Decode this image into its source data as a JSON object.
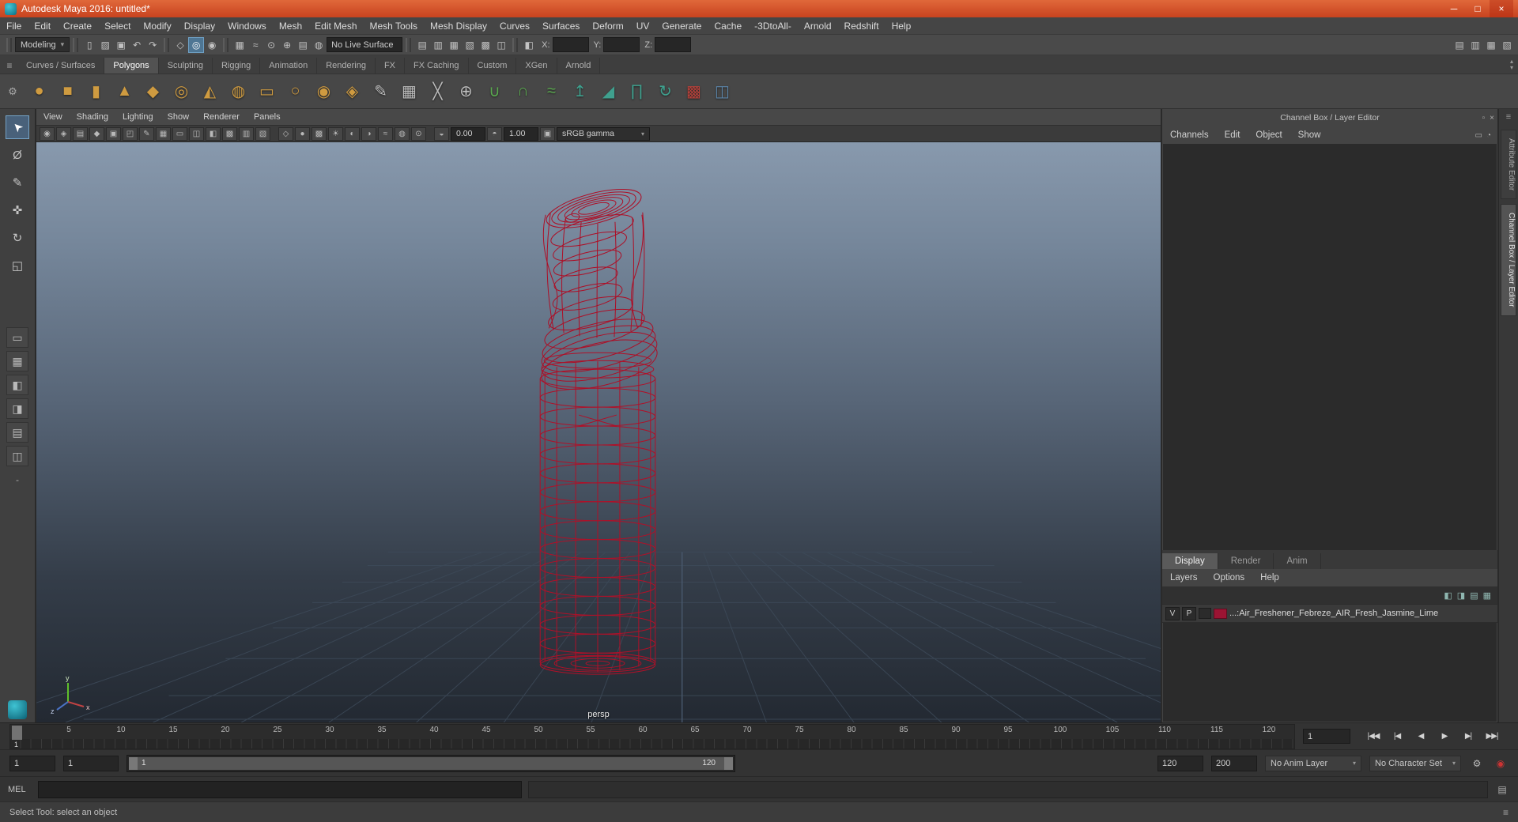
{
  "window": {
    "title": "Autodesk Maya 2016: untitled*",
    "minimize": "─",
    "maximize": "□",
    "close": "×"
  },
  "menubar": {
    "items": [
      "File",
      "Edit",
      "Create",
      "Select",
      "Modify",
      "Display",
      "Windows",
      "Mesh",
      "Edit Mesh",
      "Mesh Tools",
      "Mesh Display",
      "Curves",
      "Surfaces",
      "Deform",
      "UV",
      "Generate",
      "Cache",
      "-3DtoAll-",
      "Arnold",
      "Redshift",
      "Help"
    ]
  },
  "statusline": {
    "mode": "Modeling",
    "mode_arrow": "▾",
    "file_icons": [
      {
        "name": "new-scene-icon",
        "glyph": "▯"
      },
      {
        "name": "open-scene-icon",
        "glyph": "▨"
      },
      {
        "name": "save-scene-icon",
        "glyph": "▣"
      }
    ],
    "undo_icons": [
      {
        "name": "undo-icon",
        "glyph": "↶"
      },
      {
        "name": "redo-icon",
        "glyph": "↷"
      }
    ],
    "selection_icons": [
      {
        "name": "select-hierarchy-icon",
        "glyph": "◇"
      },
      {
        "name": "select-object-icon",
        "glyph": "◎",
        "cls": "sicon active"
      },
      {
        "name": "select-component-icon",
        "glyph": "◉"
      }
    ],
    "snap_icons": [
      {
        "name": "snap-grid-icon",
        "glyph": "▦"
      },
      {
        "name": "snap-curve-icon",
        "glyph": "≈"
      },
      {
        "name": "snap-point-icon",
        "glyph": "⊙"
      },
      {
        "name": "snap-projected-center-icon",
        "glyph": "⊕"
      },
      {
        "name": "snap-view-plane-icon",
        "glyph": "▤"
      },
      {
        "name": "make-live-icon",
        "glyph": "◍"
      }
    ],
    "live_surface": "No Live Surface",
    "history_icons": [
      {
        "name": "input-operations-icon",
        "glyph": "▤"
      },
      {
        "name": "input-connections-icon",
        "glyph": "▥"
      },
      {
        "name": "output-connections-icon",
        "glyph": "▦"
      },
      {
        "name": "construction-history-icon",
        "glyph": "▧"
      },
      {
        "name": "render-view-icon",
        "glyph": "▩"
      },
      {
        "name": "ipr-render-icon",
        "glyph": "◫"
      }
    ],
    "symmetry_icon": {
      "glyph": "◧"
    },
    "coords": {
      "x_label": "X:",
      "y_label": "Y:",
      "z_label": "Z:"
    },
    "right_icons": [
      {
        "name": "modeling-toolkit-icon",
        "glyph": "▤"
      },
      {
        "name": "attribute-editor-toggle-icon",
        "glyph": "▥"
      },
      {
        "name": "tool-settings-toggle-icon",
        "glyph": "▦"
      },
      {
        "name": "channel-box-toggle-icon",
        "glyph": "▧"
      }
    ]
  },
  "shelf": {
    "menu_icon": "≡",
    "gear_icon": "⚙",
    "scroll_up": "▴",
    "scroll_down": "▾",
    "tabs": [
      {
        "label": "Curves / Surfaces"
      },
      {
        "label": "Polygons",
        "cls": "shelf-tab active"
      },
      {
        "label": "Sculpting"
      },
      {
        "label": "Rigging"
      },
      {
        "label": "Animation"
      },
      {
        "label": "Rendering"
      },
      {
        "label": "FX"
      },
      {
        "label": "FX Caching"
      },
      {
        "label": "Custom"
      },
      {
        "label": "XGen"
      },
      {
        "label": "Arnold"
      }
    ],
    "icons": [
      {
        "name": "poly-sphere-icon",
        "glyph": "●",
        "color": "#cf9b40"
      },
      {
        "name": "poly-cube-icon",
        "glyph": "■",
        "color": "#cf9b40"
      },
      {
        "name": "poly-cylinder-icon",
        "glyph": "▮",
        "color": "#cf9b40"
      },
      {
        "name": "poly-cone-icon",
        "glyph": "▲",
        "color": "#cf9b40"
      },
      {
        "name": "poly-platonic-icon",
        "glyph": "◆",
        "color": "#cf9b40"
      },
      {
        "name": "poly-torus-icon",
        "glyph": "◎",
        "color": "#cf9b40"
      },
      {
        "name": "poly-pyramid-icon",
        "glyph": "◭",
        "color": "#cf9b40"
      },
      {
        "name": "poly-pipe-icon",
        "glyph": "◍",
        "color": "#cf9b40"
      },
      {
        "name": "poly-plane-icon",
        "glyph": "▭",
        "color": "#cf9b40"
      },
      {
        "name": "poly-disc-icon",
        "glyph": "○",
        "color": "#cf9b40"
      },
      {
        "name": "poly-super-ellipse-icon",
        "glyph": "◉",
        "color": "#cf9b40"
      },
      {
        "name": "poly-gear-icon",
        "glyph": "◈",
        "color": "#cf9b40"
      },
      {
        "name": "create-polygon-tool-icon",
        "glyph": "✎",
        "color": "#bdbdbd"
      },
      {
        "name": "quad-draw-tool-icon",
        "glyph": "▦",
        "color": "#bdbdbd"
      },
      {
        "name": "multi-cut-tool-icon",
        "glyph": "╳",
        "color": "#bdbdbd"
      },
      {
        "name": "target-weld-tool-icon",
        "glyph": "⊕",
        "color": "#bdbdbd"
      },
      {
        "name": "combine-icon",
        "glyph": "∪",
        "color": "#5aa84f"
      },
      {
        "name": "separate-icon",
        "glyph": "∩",
        "color": "#5aa84f"
      },
      {
        "name": "smooth-icon",
        "glyph": "≈",
        "color": "#5aa84f"
      },
      {
        "name": "extrude-icon",
        "glyph": "↥",
        "color": "#3fa08e"
      },
      {
        "name": "bevel-icon",
        "glyph": "◢",
        "color": "#3fa08e"
      },
      {
        "name": "bridge-icon",
        "glyph": "∏",
        "color": "#3fa08e"
      },
      {
        "name": "spin-edge-icon",
        "glyph": "↻",
        "color": "#3fa08e"
      },
      {
        "name": "boolean-icon",
        "glyph": "▩",
        "color": "#b5413a"
      },
      {
        "name": "mirror-icon",
        "glyph": "◫",
        "color": "#5b84a8"
      }
    ]
  },
  "toolbox": {
    "tools": [
      {
        "name": "select-tool",
        "glyph": "➤",
        "cls": "tool active arrow"
      },
      {
        "name": "lasso-tool",
        "glyph": "Ø"
      },
      {
        "name": "paint-select-tool",
        "glyph": "✎"
      },
      {
        "name": "move-tool",
        "glyph": "✜"
      },
      {
        "name": "rotate-tool",
        "glyph": "↻"
      },
      {
        "name": "scale-tool",
        "glyph": "◱"
      }
    ],
    "layouts": [
      {
        "name": "single-pane-layout",
        "glyph": "▭"
      },
      {
        "name": "four-pane-layout",
        "glyph": "▦"
      },
      {
        "name": "persp-outliner-layout",
        "glyph": "◧"
      },
      {
        "name": "persp-panels-layout",
        "glyph": "◨"
      },
      {
        "name": "hypershade-layout",
        "glyph": "▤"
      },
      {
        "name": "uv-editor-layout",
        "glyph": "◫"
      }
    ],
    "collapse": "-"
  },
  "panel": {
    "menus": [
      "View",
      "Shading",
      "Lighting",
      "Show",
      "Renderer",
      "Panels"
    ],
    "view_icons": [
      {
        "name": "camera-icon",
        "glyph": "◉"
      },
      {
        "name": "lock-camera-icon",
        "glyph": "◈"
      },
      {
        "name": "camera-attributes-icon",
        "glyph": "▤"
      },
      {
        "name": "bookmark-icon",
        "glyph": "◆"
      },
      {
        "name": "image-plane-icon",
        "glyph": "▣"
      },
      {
        "name": "pan-zoom-icon",
        "glyph": "◰"
      },
      {
        "name": "grease-pencil-icon",
        "glyph": "✎"
      },
      {
        "name": "grid-icon",
        "glyph": "▦"
      },
      {
        "name": "film-gate-icon",
        "glyph": "▭"
      },
      {
        "name": "resolution-gate-icon",
        "glyph": "◫"
      },
      {
        "name": "gate-mask-icon",
        "glyph": "◧"
      },
      {
        "name": "field-chart-icon",
        "glyph": "▩"
      },
      {
        "name": "safe-action-icon",
        "glyph": "▥"
      },
      {
        "name": "safe-title-icon",
        "glyph": "▧"
      }
    ],
    "shading_icons": [
      {
        "name": "wireframe-icon",
        "glyph": "◇"
      },
      {
        "name": "smooth-shade-icon",
        "glyph": "●"
      },
      {
        "name": "textured-icon",
        "glyph": "▩"
      },
      {
        "name": "lights-icon",
        "glyph": "☀"
      },
      {
        "name": "shadows-icon",
        "glyph": "◐"
      },
      {
        "name": "ambient-occlusion-icon",
        "glyph": "◑"
      },
      {
        "name": "motion-blur-icon",
        "glyph": "≈"
      },
      {
        "name": "xray-icon",
        "glyph": "◍"
      },
      {
        "name": "isolate-select-icon",
        "glyph": "⊙"
      }
    ],
    "exposure_icon": "◒",
    "exposure": "0.00",
    "contrast_icon": "◓",
    "gamma": "1.00",
    "colorspace_icon": "▣",
    "colorspace": "sRGB gamma",
    "combo_arrow": "▾",
    "camera": "persp",
    "axis": {
      "x": "x",
      "y": "y",
      "z": "z"
    }
  },
  "channelbox": {
    "title": "Channel Box / Layer Editor",
    "pin_icon": "▫",
    "close_icon": "×",
    "menus": [
      "Channels",
      "Edit",
      "Object",
      "Show"
    ],
    "mode_icons": [
      {
        "name": "slider-mode-icon",
        "glyph": "▭"
      },
      {
        "name": "speed-mode-icon",
        "glyph": "◔"
      }
    ],
    "tabs": [
      {
        "label": "Display",
        "cls": "cb-tab active"
      },
      {
        "label": "Render"
      },
      {
        "label": "Anim"
      }
    ],
    "layer_menus": [
      "Layers",
      "Options",
      "Help"
    ],
    "layer_icons": [
      {
        "name": "layer-visibility-icon",
        "glyph": "◧"
      },
      {
        "name": "layer-playback-icon",
        "glyph": "◨"
      },
      {
        "name": "new-empty-layer-icon",
        "glyph": "▤"
      },
      {
        "name": "new-layer-from-selected-icon",
        "glyph": "▦"
      }
    ],
    "layer": {
      "visible": "V",
      "playback": "P",
      "color": "#9b1433",
      "name": "...:Air_Freshener_Febreze_AIR_Fresh_Jasmine_Lime"
    }
  },
  "sidebar": {
    "menu_icon": "≡",
    "tabs": [
      {
        "label": "Attribute Editor"
      },
      {
        "label": "Channel Box / Layer Editor",
        "cls": "side-tab active"
      }
    ]
  },
  "timeline": {
    "ticks": [
      "5",
      "10",
      "15",
      "20",
      "25",
      "30",
      "35",
      "40",
      "45",
      "50",
      "55",
      "60",
      "65",
      "70",
      "75",
      "80",
      "85",
      "90",
      "95",
      "100",
      "105",
      "110",
      "115",
      "120"
    ],
    "playhead_frame": "1",
    "frame_field": "1",
    "transport": [
      {
        "name": "go-to-start-button",
        "glyph": "|◀◀"
      },
      {
        "name": "step-back-button",
        "glyph": "|◀"
      },
      {
        "name": "play-backwards-button",
        "glyph": "◀"
      },
      {
        "name": "play-forwards-button",
        "glyph": "▶"
      },
      {
        "name": "step-forward-button",
        "glyph": "▶|"
      },
      {
        "name": "go-to-end-button",
        "glyph": "▶▶|"
      }
    ]
  },
  "range": {
    "anim_start": "1",
    "playback_start": "1",
    "range_start_label": "1",
    "range_end_label": "120",
    "playback_end": "120",
    "anim_end": "200",
    "anim_layer": "No Anim Layer",
    "character_set": "No Character Set",
    "dropdown_arrow": "▾",
    "prefs_icon": "⚙",
    "autokey_icon": "◉"
  },
  "command": {
    "label": "MEL",
    "panel_icon": "▤"
  },
  "helpline": {
    "text": "Select Tool: select an object",
    "icon": "≡"
  }
}
